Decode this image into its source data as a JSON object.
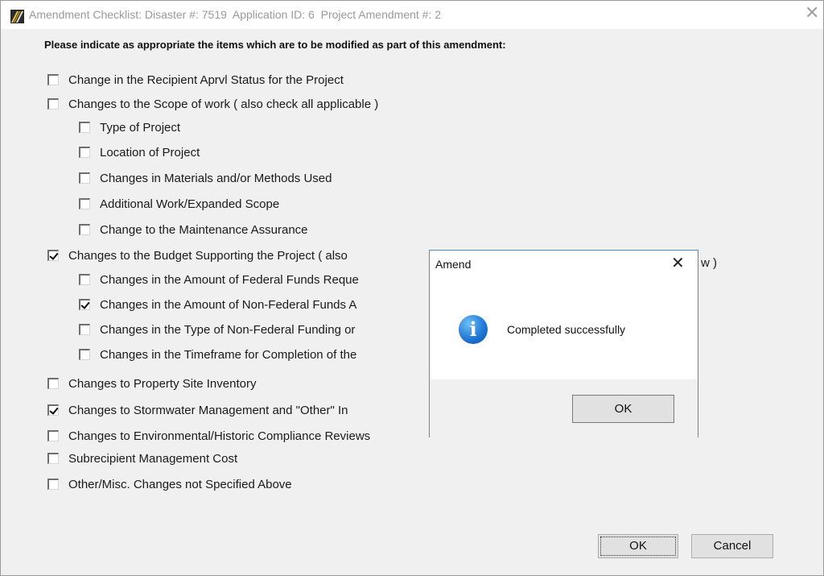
{
  "window": {
    "title": "Amendment Checklist: Disaster #: 7519  Application ID: 6  Project Amendment #: 2",
    "close_glyph": "✕"
  },
  "instructions": "Please indicate as appropriate the items which are to be modified as part of this amendment:",
  "checklist": [
    {
      "label": "Change in the Recipient Aprvl Status for the Project",
      "checked": false
    },
    {
      "label": "Changes to the Scope of work ( also check all applicable )",
      "checked": false
    },
    {
      "label": "Type of Project",
      "checked": false
    },
    {
      "label": "Location of Project",
      "checked": false
    },
    {
      "label": "Changes in Materials and/or Methods Used",
      "checked": false
    },
    {
      "label": "Additional Work/Expanded Scope",
      "checked": false
    },
    {
      "label": "Change to the Maintenance Assurance",
      "checked": false
    },
    {
      "label": "Changes to the Budget Supporting the Project ( also",
      "label_end": "w )",
      "checked": true
    },
    {
      "label": "Changes in the Amount of Federal Funds Reque",
      "checked": false
    },
    {
      "label": "Changes in the Amount of Non-Federal Funds A",
      "checked": true
    },
    {
      "label": "Changes in the Type of Non-Federal Funding or",
      "checked": false
    },
    {
      "label": "Changes in the Timeframe for Completion of the",
      "checked": false
    },
    {
      "label": "Changes to Property Site Inventory",
      "checked": false
    },
    {
      "label": "Changes to Stormwater Management and \"Other\" In",
      "checked": true
    },
    {
      "label": "Changes to Environmental/Historic Compliance Reviews",
      "checked": false
    },
    {
      "label": "Subrecipient Management Cost",
      "checked": false
    },
    {
      "label": "Other/Misc. Changes not Specified Above",
      "checked": false
    }
  ],
  "buttons": {
    "ok": "OK",
    "cancel": "Cancel"
  },
  "dialog": {
    "title": "Amend",
    "close_glyph": "✕",
    "icon": "information-icon",
    "icon_glyph": "i",
    "message": "Completed successfully",
    "ok": "OK"
  }
}
